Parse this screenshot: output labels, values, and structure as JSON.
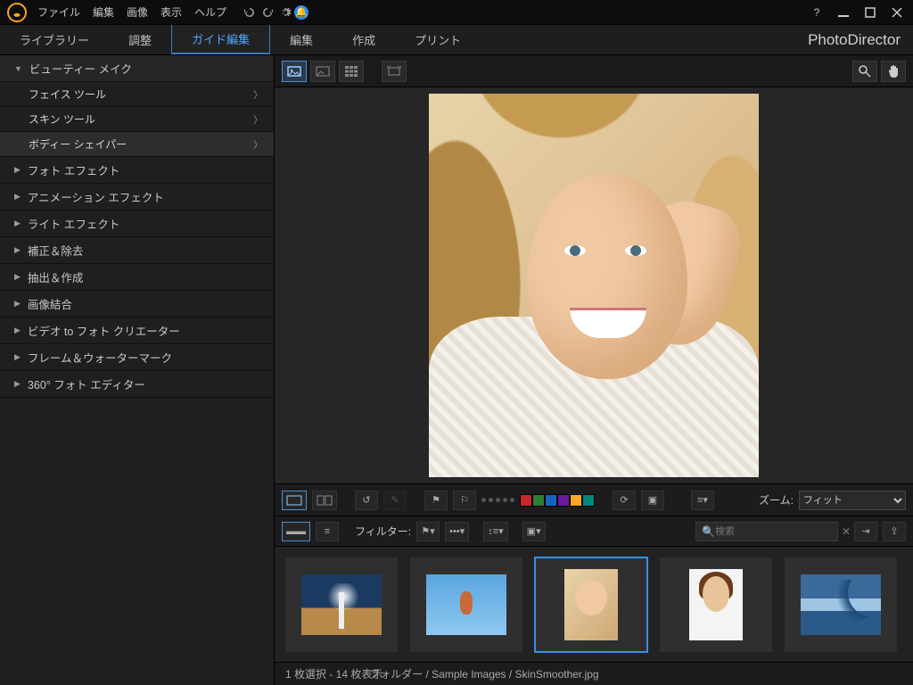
{
  "menubar": [
    "ファイル",
    "編集",
    "画像",
    "表示",
    "ヘルプ"
  ],
  "brand": "PhotoDirector",
  "tabs": [
    {
      "label": "ライブラリー",
      "active": false
    },
    {
      "label": "調整",
      "active": false
    },
    {
      "label": "ガイド編集",
      "active": true
    },
    {
      "label": "編集",
      "active": false
    },
    {
      "label": "作成",
      "active": false
    },
    {
      "label": "プリント",
      "active": false
    }
  ],
  "sidebar": {
    "expanded": {
      "label": "ビューティー メイク",
      "subs": [
        "フェイス ツール",
        "スキン ツール",
        "ボディー シェイパー"
      ]
    },
    "cats": [
      "フォト エフェクト",
      "アニメーション エフェクト",
      "ライト エフェクト",
      "補正＆除去",
      "抽出＆作成",
      "画像結合",
      "ビデオ to フォト クリエーター",
      "フレーム＆ウォーターマーク",
      "360° フォト エディター"
    ]
  },
  "swatch_colors": [
    "#c62828",
    "#2e7d32",
    "#1565c0",
    "#6a1b9a",
    "#f9a825",
    "#00897b"
  ],
  "zoom": {
    "label": "ズーム:",
    "value": "フィット"
  },
  "toolbar3": {
    "filter_label": "フィルター:",
    "search_placeholder": "検索"
  },
  "status": {
    "selection": "1 枚選択 - 14 枚表示",
    "path": "フォルダー / Sample Images / SkinSmoother.jpg"
  }
}
